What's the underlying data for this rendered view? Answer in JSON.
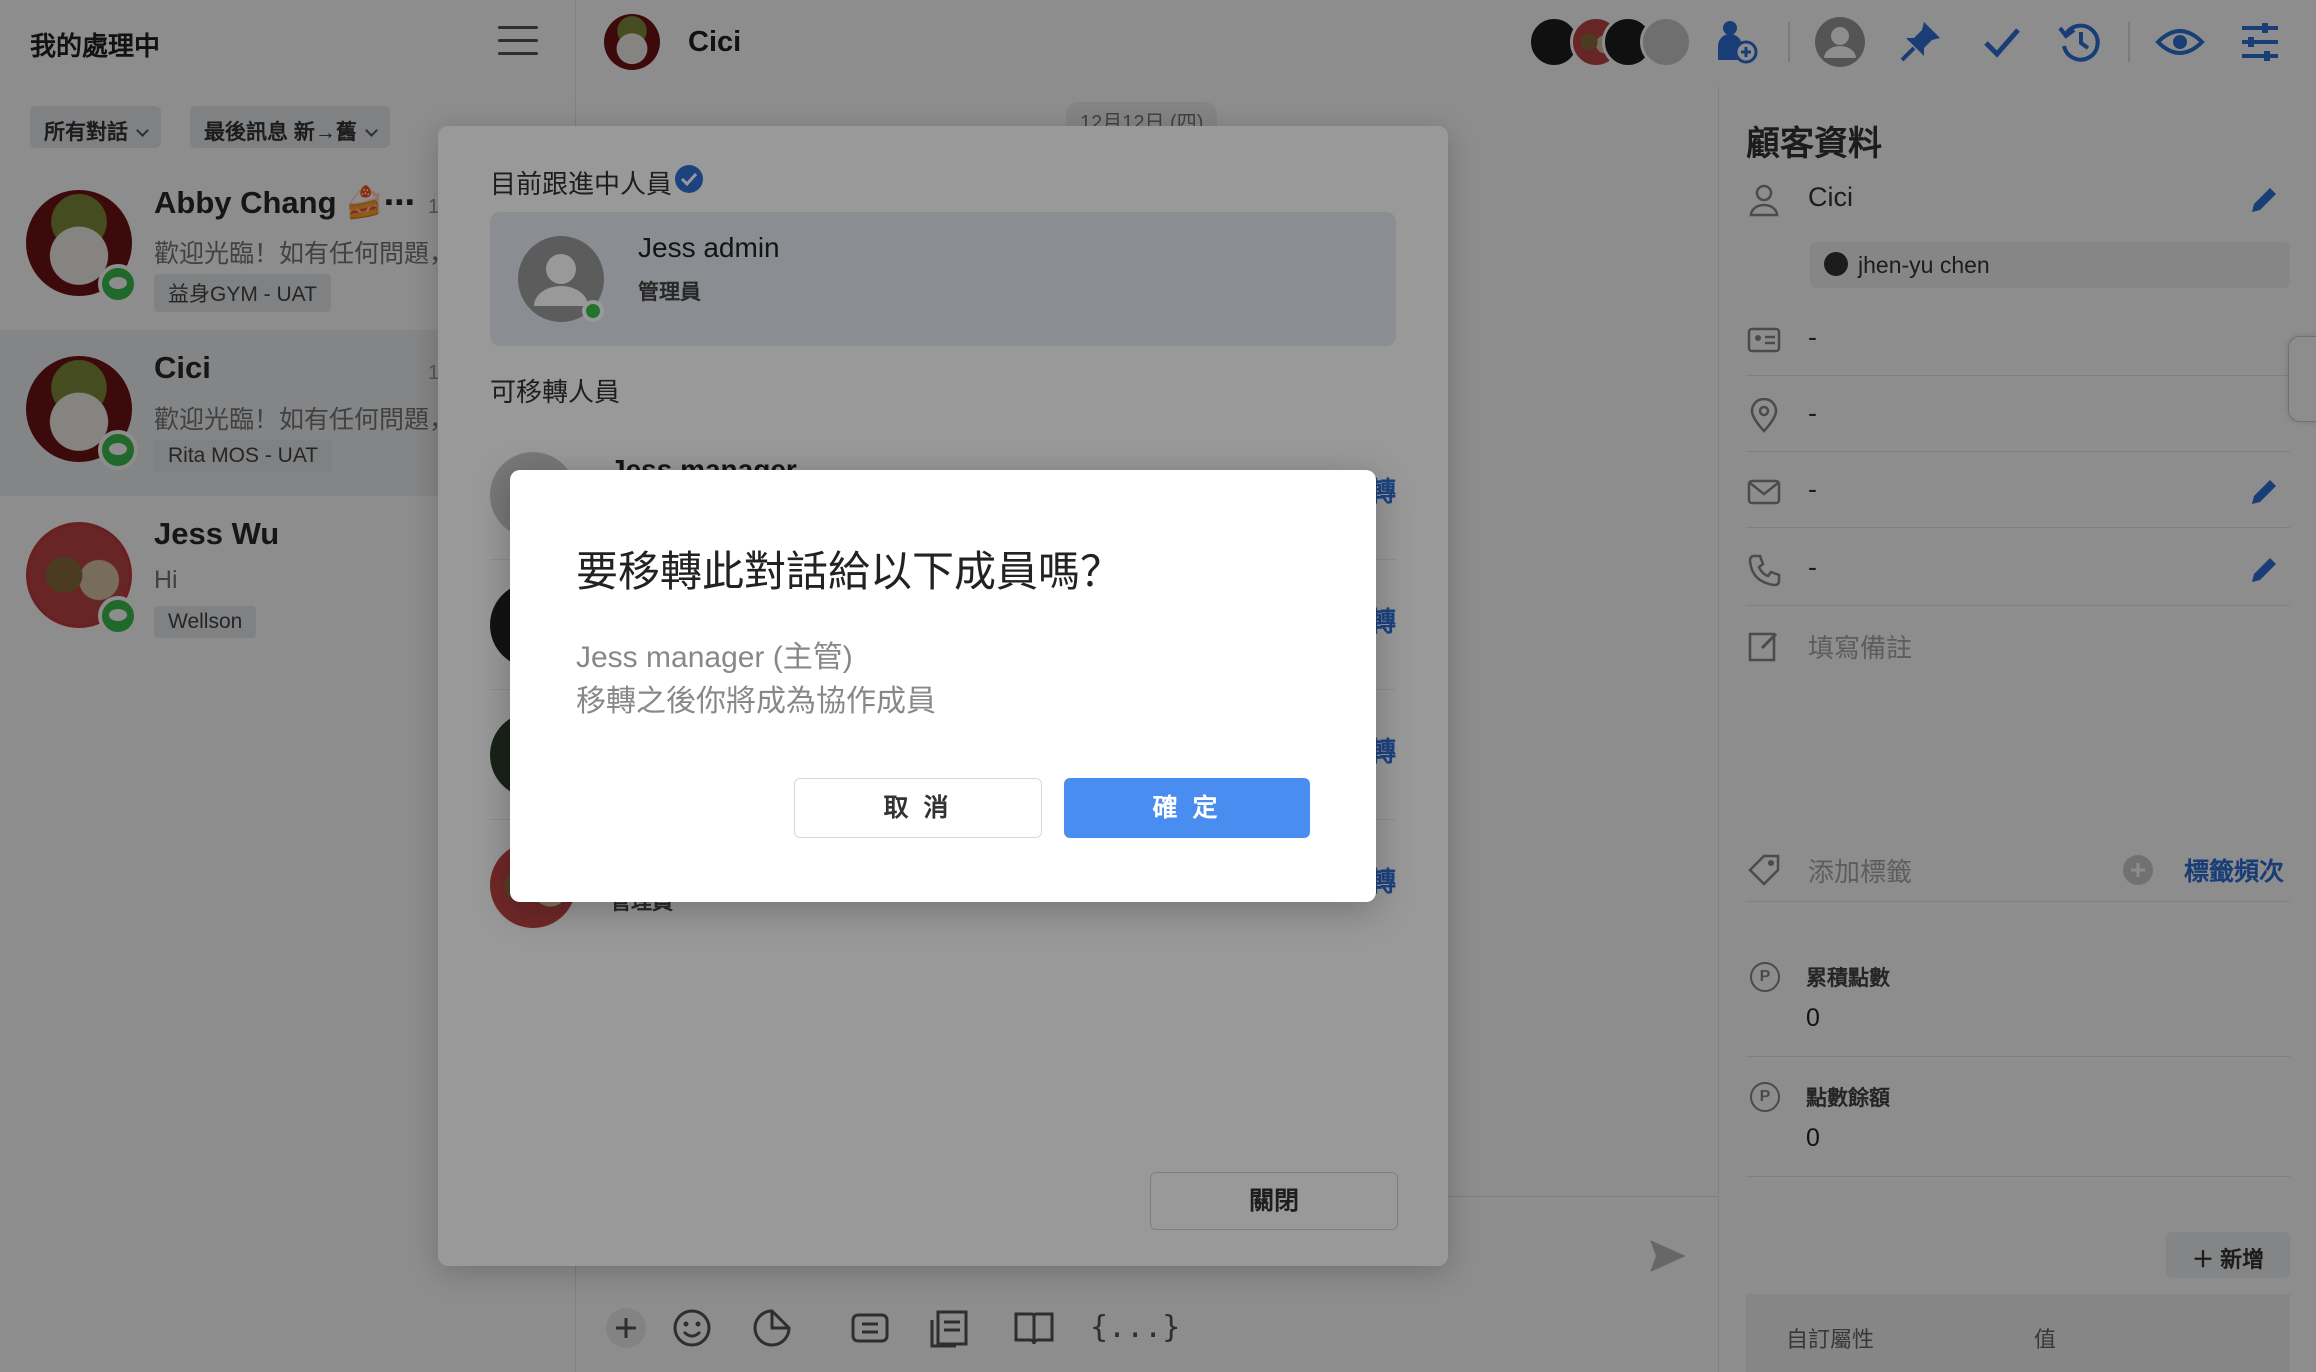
{
  "sidebar": {
    "title": "我的處理中",
    "filter_all": "所有對話",
    "filter_sort": "最後訊息 新→舊",
    "conversations": [
      {
        "name": "Abby Chang 🍰⋯",
        "time": "1",
        "message": "歡迎光臨！如有任何問題，",
        "tag": "益身GYM - UAT"
      },
      {
        "name": "Cici",
        "time": "1",
        "message": "歡迎光臨！如有任何問題，",
        "tag": "Rita MOS - UAT"
      },
      {
        "name": "Jess Wu",
        "time": "",
        "message": "Hi",
        "tag": "Wellson"
      }
    ]
  },
  "header": {
    "contact_name": "Cici",
    "icons": [
      "add-follower-icon",
      "user-avatar-icon",
      "pin-icon",
      "check-icon",
      "history-icon",
      "eye-icon",
      "settings-sliders-icon"
    ]
  },
  "chat": {
    "date_label": "12月12日 (四)",
    "toolbar_more": "{...}"
  },
  "panel": {
    "title": "顧客資料",
    "name": "Cici",
    "line_account": "jhen-yu chen",
    "id_value": "-",
    "location_value": "-",
    "email_value": "-",
    "phone_value": "-",
    "note_placeholder": "填寫備註",
    "tag_placeholder": "添加標籤",
    "tag_frequency": "標籤頻次",
    "points_total_label": "累積點數",
    "points_total_value": "0",
    "points_balance_label": "點數餘額",
    "points_balance_value": "0",
    "add_button": "＋ 新增",
    "attr_key_header": "自訂屬性",
    "attr_value_header": "值"
  },
  "transfer_modal": {
    "current_label": "目前跟進中人員",
    "current_name": "Jess admin",
    "current_role": "管理員",
    "available_label": "可移轉人員",
    "members": [
      {
        "name": "Jess manager",
        "role": "",
        "action": "轉"
      },
      {
        "name": "",
        "role": "",
        "action": "轉"
      },
      {
        "name": "",
        "role": "",
        "action": "轉"
      },
      {
        "name": "",
        "role": "管理員",
        "action": "轉"
      }
    ],
    "close_label": "關閉"
  },
  "confirm_dialog": {
    "title": "要移轉此對話給以下成員嗎？",
    "line1": "Jess manager (主管)",
    "line2": "移轉之後你將成為協作成員",
    "cancel_label": "取 消",
    "ok_label": "確 定"
  },
  "colors": {
    "accent": "#4a8df0",
    "link": "#2f6fd6",
    "online": "#3bbf4c"
  }
}
